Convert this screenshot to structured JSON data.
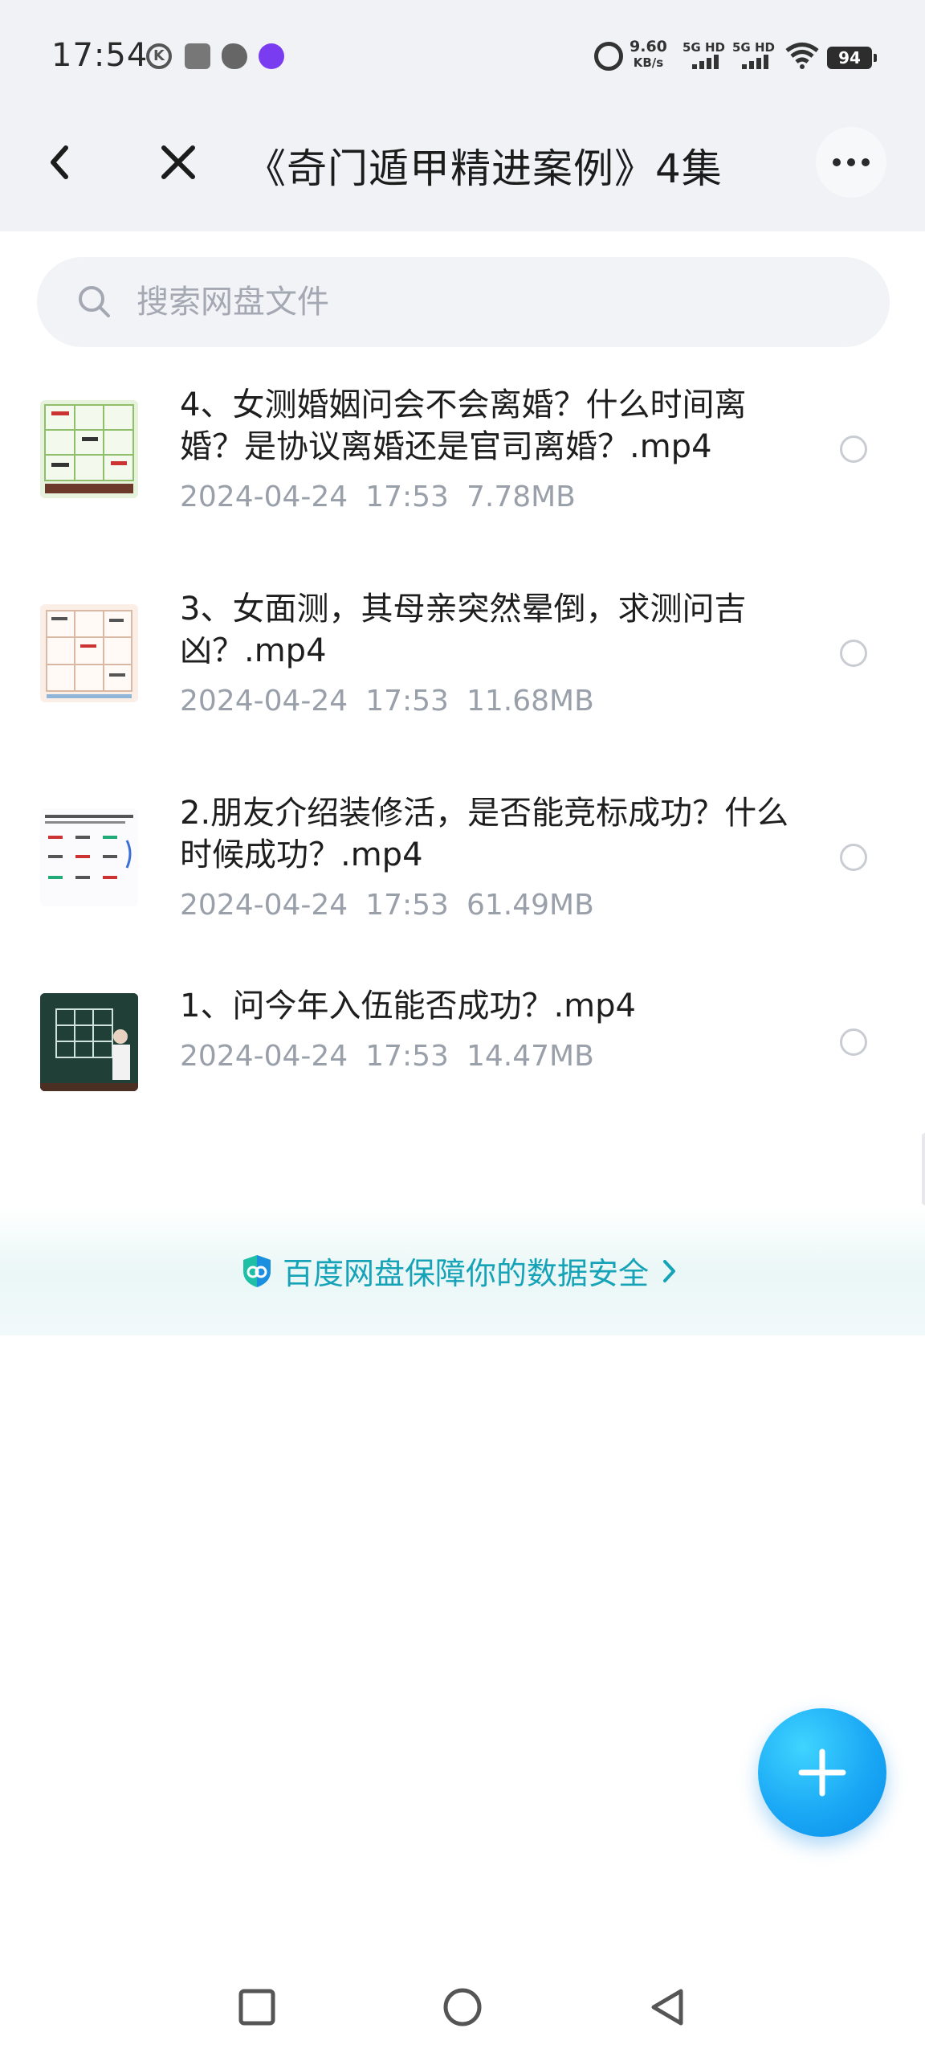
{
  "status_bar": {
    "time": "17:54",
    "net_speed_value": "9.60",
    "net_speed_unit": "KB/s",
    "sim1_label": "5G HD",
    "sim2_label": "5G HD",
    "battery": "94",
    "icons": [
      "k-app-icon",
      "app-square-icon",
      "wechat-icon",
      "link-app-icon",
      "alarm-icon",
      "signal-icon",
      "wifi-icon",
      "battery-icon"
    ]
  },
  "header": {
    "title": "《奇门遁甲精进案例》4集",
    "back_icon": "chevron-left-icon",
    "close_icon": "close-icon",
    "more_icon": "more-dots-icon"
  },
  "search": {
    "placeholder": "搜索网盘文件",
    "value": ""
  },
  "files": [
    {
      "name": "4、女测婚姻问会不会离婚？什么时间离婚？是协议离婚还是官司离婚？.mp4",
      "date": "2024-04-24",
      "time": "17:53",
      "size": "7.78MB",
      "thumbnail": "chart-grid-thumbnail",
      "selected": false
    },
    {
      "name": "3、女面测，其母亲突然晕倒，求测问吉凶？.mp4",
      "date": "2024-04-24",
      "time": "17:53",
      "size": "11.68MB",
      "thumbnail": "chart-grid-thumbnail",
      "selected": false
    },
    {
      "name": "2.朋友介绍装修活，是否能竞标成功？什么时候成功？.mp4",
      "date": "2024-04-24",
      "time": "17:53",
      "size": "61.49MB",
      "thumbnail": "document-thumbnail",
      "selected": false
    },
    {
      "name": "1、问今年入伍能否成功？.mp4",
      "date": "2024-04-24",
      "time": "17:53",
      "size": "14.47MB",
      "thumbnail": "blackboard-thumbnail",
      "selected": false
    }
  ],
  "banner": {
    "text": "百度网盘保障你的数据安全",
    "icon": "shield-icon",
    "color": "#16a3b8"
  },
  "fab": {
    "icon": "plus-icon",
    "color": "#1aa8f5"
  },
  "nav_bar": {
    "icons": [
      "recents-square-icon",
      "home-circle-icon",
      "back-triangle-icon"
    ]
  }
}
